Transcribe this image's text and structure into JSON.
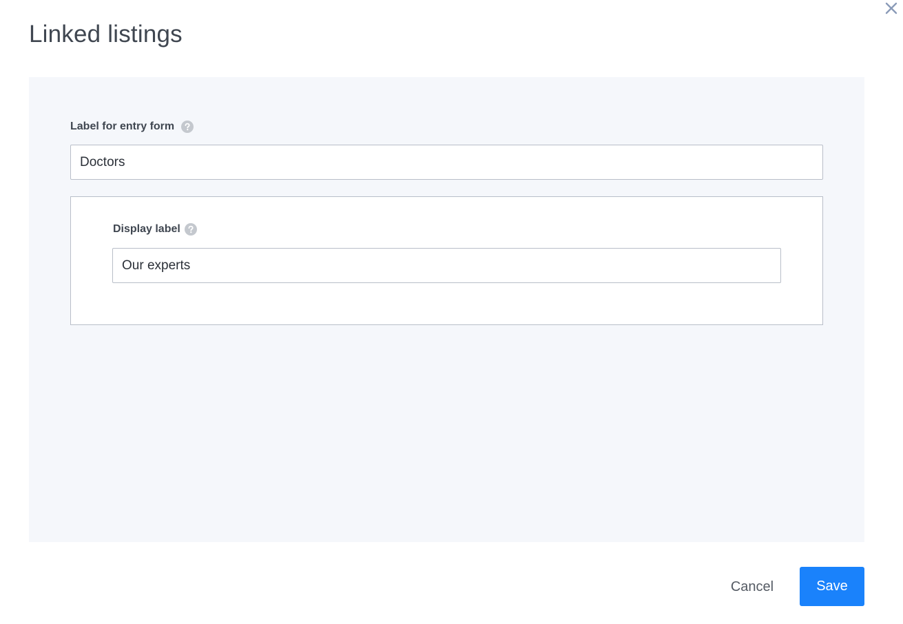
{
  "dialog": {
    "title": "Linked listings",
    "close_icon": "close-icon"
  },
  "form": {
    "entry_label": "Label for entry form",
    "entry_value": "Doctors",
    "display_label": "Display label",
    "display_value": "Our experts",
    "help_icon": "question-circle-icon"
  },
  "footer": {
    "cancel_label": "Cancel",
    "save_label": "Save"
  },
  "colors": {
    "accent": "#1a82fb",
    "panel_background": "#f5f7fb",
    "border": "#b8bec8",
    "close_icon": "#8a9bb8",
    "help_icon": "#c4c8ce"
  }
}
